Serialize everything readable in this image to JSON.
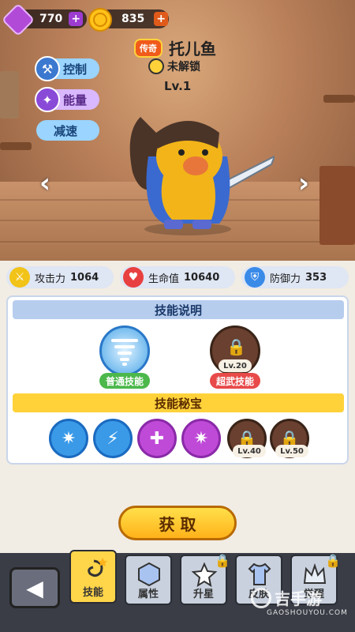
{
  "currency": {
    "gems": "770",
    "coins": "835"
  },
  "character": {
    "rarity": "传奇",
    "name": "托儿鱼",
    "status": "未解锁",
    "level": "Lv.1"
  },
  "traits": [
    "控制",
    "能量",
    "减速"
  ],
  "stats": [
    {
      "label": "攻击力",
      "value": "1064"
    },
    {
      "label": "生命值",
      "value": "10640"
    },
    {
      "label": "防御力",
      "value": "353"
    }
  ],
  "skills_section": {
    "title": "技能说明",
    "normal_label": "普通技能",
    "ultimate_label": "超武技能",
    "ultimate_level": "Lv.20"
  },
  "treasure_section": {
    "title": "技能秘宝",
    "locked_levels": [
      "Lv.40",
      "Lv.50"
    ]
  },
  "get_button": "获 取",
  "tabs": [
    "技能",
    "属性",
    "升星",
    "皮肤",
    "觉醒"
  ],
  "watermark": {
    "text": "吉手游",
    "url": "GAOSHOUYOU.COM"
  },
  "colors": {
    "accent_yellow": "#ffd54a",
    "banner_blue": "#b7cdee",
    "banner_yellow": "#ffd23a",
    "attack": "#f2c318",
    "health": "#e84040",
    "defense": "#3a8ae8"
  },
  "icons": [
    "gem-icon",
    "coin-icon",
    "hammer-icon",
    "energy-icon",
    "sword-icon",
    "heart-icon",
    "shield-icon",
    "tornado-icon",
    "lock-icon"
  ]
}
